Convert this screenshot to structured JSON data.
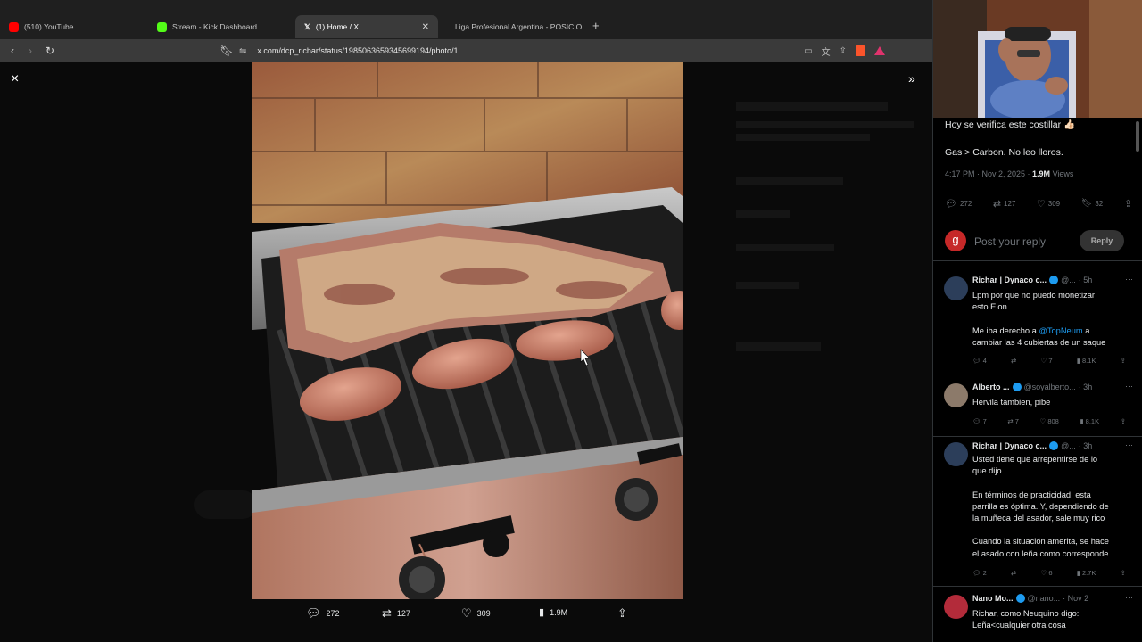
{
  "browser": {
    "tabs": [
      {
        "label": "(510) YouTube",
        "color": "#ff0000"
      },
      {
        "label": "Stream - Kick Dashboard",
        "color": "#53fc18"
      },
      {
        "label": "(1) Home / X",
        "color": "#ffffff"
      },
      {
        "label": "Liga Profesional Argentina - POSICIO",
        "color": "#2ecc71"
      }
    ],
    "url": "x.com/dcp_richar/status/1985063659345699194/photo/1"
  },
  "viewer": {
    "close_icon": "×",
    "expand_icon": "»",
    "bottom_bar": {
      "replies": "272",
      "retweets": "127",
      "likes": "309",
      "views": "1.9M"
    }
  },
  "tweet": {
    "text1": "Hoy se verifica este costillar 👍🏻",
    "text2": "Gas > Carbon. No leo lloros.",
    "time": "4:17 PM · Nov 2, 2025 · ",
    "views": "1.9M",
    "views_label": " Views",
    "stats": {
      "replies": "272",
      "retweets": "127",
      "likes": "309",
      "bookmarks": "32"
    }
  },
  "reply_box": {
    "avatar_letter": "g",
    "placeholder": "Post your reply",
    "button": "Reply"
  },
  "replies": [
    {
      "name": "Richar | Dynaco c...",
      "handle": "@...",
      "time": "· 5h",
      "lines": [
        "Lpm por que no puedo monetizar",
        "esto Elon..."
      ],
      "lines2_pre": "Me iba derecho a ",
      "lines2_link": "@TopNeum",
      "lines2_post": " a",
      "lines3": "cambiar las 4 cubiertas de un saque",
      "stats": {
        "replies": "4",
        "retweets": "",
        "likes": "7",
        "views": "8.1K"
      }
    },
    {
      "name": "Alberto ...",
      "handle": "@soyalberto...",
      "time": "· 3h",
      "text": "Hervila tambien, pibe",
      "stats": {
        "replies": "7",
        "retweets": "7",
        "likes": "808",
        "views": "8.1K"
      }
    },
    {
      "name": "Richar | Dynaco c...",
      "handle": "@...",
      "time": "· 3h",
      "p1": [
        "Usted tiene que arrepentirse de lo",
        "que dijo."
      ],
      "p2": [
        "En términos de practicidad, esta",
        "parrilla es óptima. Y, dependiendo de",
        "la muñeca del asador, sale muy rico"
      ],
      "p3": [
        "Cuando la situación amerita, se hace",
        "el asado con leña como corresponde."
      ],
      "stats": {
        "replies": "2",
        "retweets": "",
        "likes": "6",
        "views": "2.7K"
      }
    },
    {
      "name": "Nano Mo...",
      "handle": "@nano...",
      "time": "· Nov 2",
      "lines": [
        "Richar, como Neuquino digo:",
        "Leña<cualquier otra cosa"
      ]
    }
  ],
  "colors": {
    "accent": "#1d9bf0",
    "background": "#000000",
    "muted": "#71767b"
  }
}
